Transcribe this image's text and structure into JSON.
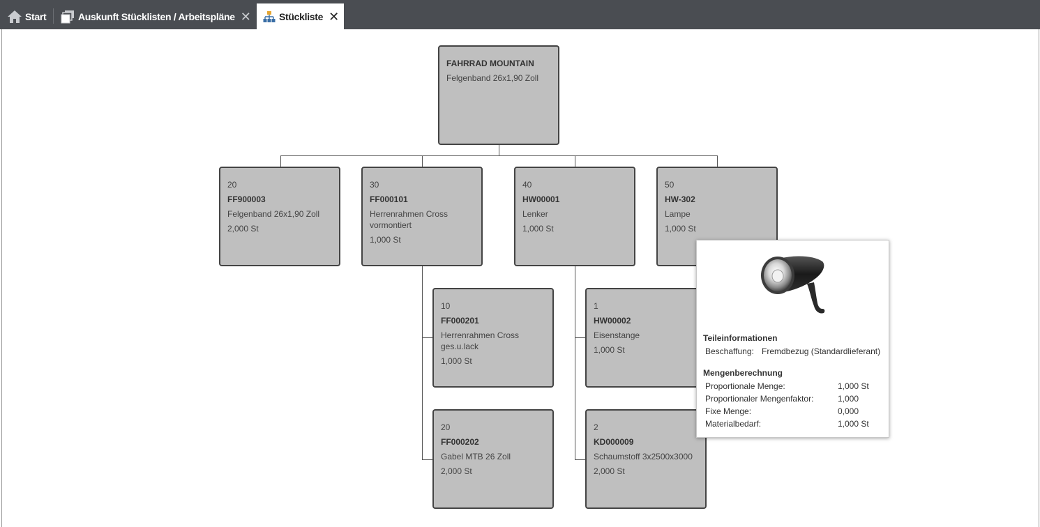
{
  "tabs": [
    {
      "label": "Start",
      "icon": "home-icon"
    },
    {
      "label": "Auskunft Stücklisten / Arbeitspläne",
      "icon": "windows-icon",
      "closable": true
    },
    {
      "label": "Stückliste",
      "icon": "sitemap-icon",
      "closable": true,
      "active": true
    }
  ],
  "tree": {
    "root": {
      "number": "FAHRRAD MOUNTAIN",
      "description": "Felgenband 26x1,90 Zoll"
    },
    "children": [
      {
        "pos": "20",
        "number": "FF900003",
        "description": "Felgenband 26x1,90 Zoll",
        "qty": "2,000 St"
      },
      {
        "pos": "30",
        "number": "FF000101",
        "description": "Herrenrahmen Cross vormontiert",
        "qty": "1,000 St",
        "children": [
          {
            "pos": "10",
            "number": "FF000201",
            "description": "Herrenrahmen Cross ges.u.lack",
            "qty": "1,000 St"
          },
          {
            "pos": "20",
            "number": "FF000202",
            "description": "Gabel MTB 26 Zoll",
            "qty": "2,000 St"
          }
        ]
      },
      {
        "pos": "40",
        "number": "HW00001",
        "description": "Lenker",
        "qty": "1,000 St",
        "children": [
          {
            "pos": "1",
            "number": "HW00002",
            "description": "Eisenstange",
            "qty": "1,000 St"
          },
          {
            "pos": "2",
            "number": "KD000009",
            "description": "Schaumstoff 3x2500x3000",
            "qty": "2,000 St"
          }
        ]
      },
      {
        "pos": "50",
        "number": "HW-302",
        "description": "Lampe",
        "qty": "1,000 St"
      }
    ]
  },
  "tooltip": {
    "image": "bicycle-lamp-image",
    "section1_title": "Teileinformationen",
    "beschaffung_label": "Beschaffung:",
    "beschaffung_value": "Fremdbezug (Standardlieferant)",
    "section2_title": "Mengenberechnung",
    "rows": [
      {
        "label": "Proportionale Menge:",
        "value": "1,000 St"
      },
      {
        "label": "Proportionaler Mengenfaktor:",
        "value": "1,000"
      },
      {
        "label": "Fixe Menge:",
        "value": "0,000"
      },
      {
        "label": "Materialbedarf:",
        "value": "1,000 St"
      }
    ]
  },
  "colors": {
    "tabbar": "#4a4d52",
    "node_fill": "#bfbfbf",
    "node_border": "#444444"
  }
}
